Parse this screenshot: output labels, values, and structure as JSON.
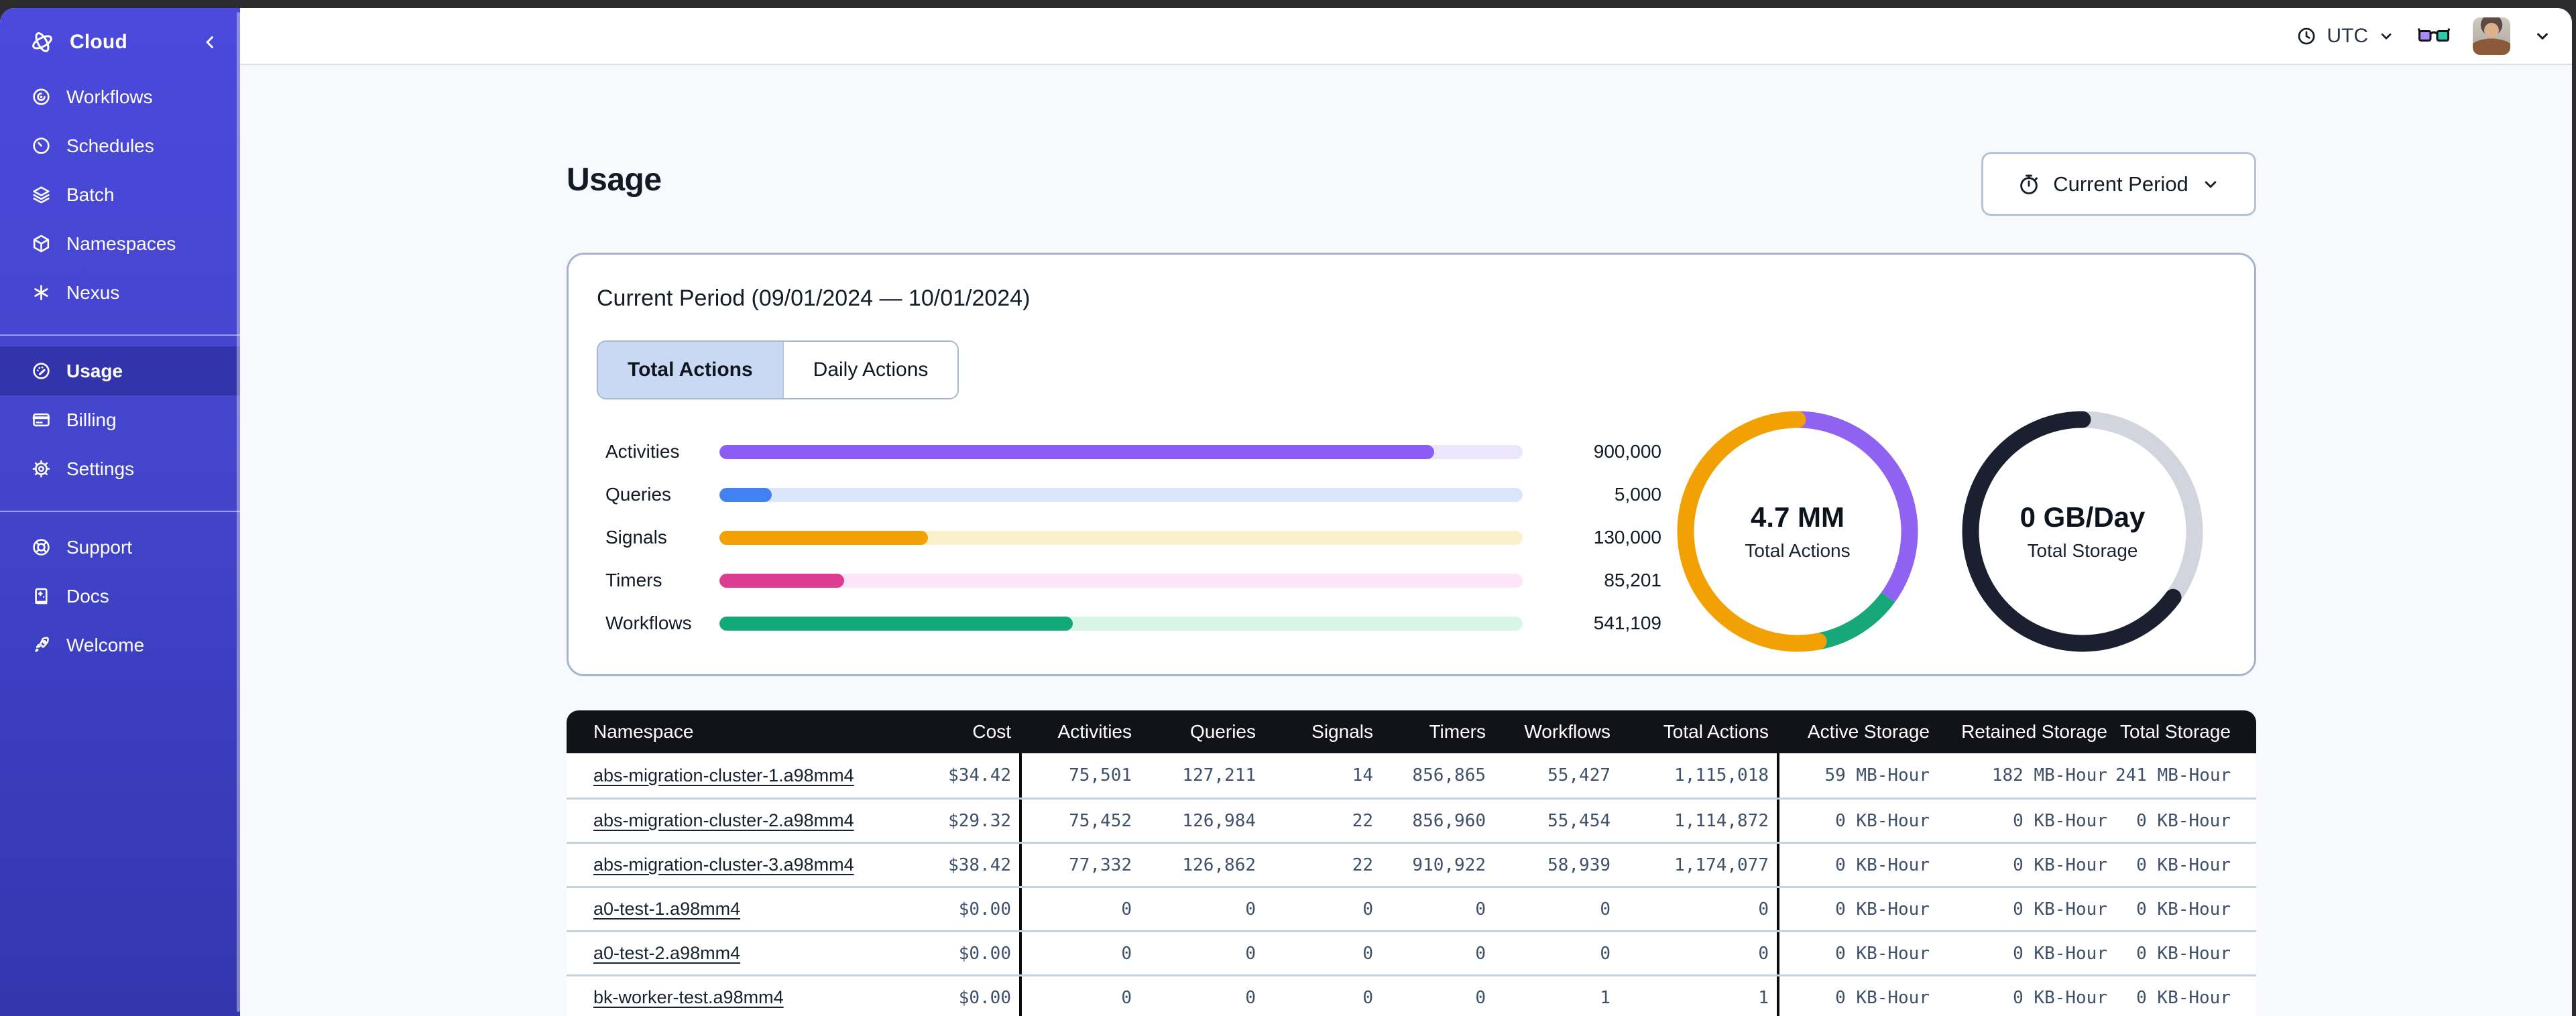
{
  "topbar": {
    "timezone": "UTC"
  },
  "sidebar": {
    "brand": "Cloud",
    "nav_primary": [
      {
        "icon": "workflows-icon",
        "label": "Workflows"
      },
      {
        "icon": "schedules-icon",
        "label": "Schedules"
      },
      {
        "icon": "batch-icon",
        "label": "Batch"
      },
      {
        "icon": "namespaces-icon",
        "label": "Namespaces"
      },
      {
        "icon": "nexus-icon",
        "label": "Nexus"
      }
    ],
    "nav_account": [
      {
        "icon": "usage-icon",
        "label": "Usage",
        "active": true
      },
      {
        "icon": "billing-icon",
        "label": "Billing"
      },
      {
        "icon": "settings-icon",
        "label": "Settings"
      }
    ],
    "nav_support": [
      {
        "icon": "support-icon",
        "label": "Support"
      },
      {
        "icon": "docs-icon",
        "label": "Docs"
      },
      {
        "icon": "welcome-icon",
        "label": "Welcome"
      }
    ]
  },
  "page": {
    "title": "Usage",
    "period_button": "Current Period"
  },
  "card": {
    "title": "Current Period (09/01/2024 — 10/01/2024)",
    "tabs": [
      {
        "label": "Total Actions",
        "active": true
      },
      {
        "label": "Daily Actions",
        "active": false
      }
    ]
  },
  "chart_data": [
    {
      "type": "bar",
      "title": "Current Period usage by action type",
      "categories": [
        "Activities",
        "Queries",
        "Signals",
        "Timers",
        "Workflows"
      ],
      "values": [
        900000,
        5000,
        130000,
        85201,
        541109
      ],
      "rows": [
        {
          "label": "Activities",
          "value_label": "900,000",
          "percent": 89,
          "color": "#8b5cf6",
          "track": "#ece6fc"
        },
        {
          "label": "Queries",
          "value_label": "5,000",
          "percent": 6.5,
          "color": "#4181f2",
          "track": "#dbe6fa"
        },
        {
          "label": "Signals",
          "value_label": "130,000",
          "percent": 26,
          "color": "#f2a104",
          "track": "#fbf0cc"
        },
        {
          "label": "Timers",
          "value_label": "85,201",
          "percent": 15.5,
          "color": "#dd3d90",
          "track": "#fae6f7"
        },
        {
          "label": "Workflows",
          "value_label": "541,109",
          "percent": 44,
          "color": "#12a877",
          "track": "#d7f6e8"
        }
      ]
    },
    {
      "type": "donut",
      "center_label": "4.7 MM",
      "sub_label": "Total Actions",
      "segments": [
        {
          "name": "purple",
          "color": "#8f62f2",
          "fraction": 0.35
        },
        {
          "name": "green",
          "color": "#16a878",
          "fraction": 0.12
        },
        {
          "name": "orange",
          "color": "#f2a104",
          "fraction": 0.53,
          "cap": "round"
        }
      ]
    },
    {
      "type": "donut",
      "center_label": "0 GB/Day",
      "sub_label": "Total Storage",
      "segments": [
        {
          "name": "gray",
          "color": "#d2d5dd",
          "fraction": 0.35
        },
        {
          "name": "navy",
          "color": "#1b2030",
          "fraction": 0.65,
          "cap": "round"
        }
      ]
    }
  ],
  "table": {
    "columns": [
      "Namespace",
      "Cost",
      "Activities",
      "Queries",
      "Signals",
      "Timers",
      "Workflows",
      "Total Actions",
      "Active Storage",
      "Retained Storage",
      "Total Storage"
    ],
    "rows": [
      [
        "abs-migration-cluster-1.a98mm4",
        "$34.42",
        "75,501",
        "127,211",
        "14",
        "856,865",
        "55,427",
        "1,115,018",
        "59 MB-Hour",
        "182 MB-Hour",
        "241 MB-Hour"
      ],
      [
        "abs-migration-cluster-2.a98mm4",
        "$29.32",
        "75,452",
        "126,984",
        "22",
        "856,960",
        "55,454",
        "1,114,872",
        "0 KB-Hour",
        "0 KB-Hour",
        "0 KB-Hour"
      ],
      [
        "abs-migration-cluster-3.a98mm4",
        "$38.42",
        "77,332",
        "126,862",
        "22",
        "910,922",
        "58,939",
        "1,174,077",
        "0 KB-Hour",
        "0 KB-Hour",
        "0 KB-Hour"
      ],
      [
        "a0-test-1.a98mm4",
        "$0.00",
        "0",
        "0",
        "0",
        "0",
        "0",
        "0",
        "0 KB-Hour",
        "0 KB-Hour",
        "0 KB-Hour"
      ],
      [
        "a0-test-2.a98mm4",
        "$0.00",
        "0",
        "0",
        "0",
        "0",
        "0",
        "0",
        "0 KB-Hour",
        "0 KB-Hour",
        "0 KB-Hour"
      ],
      [
        "bk-worker-test.a98mm4",
        "$0.00",
        "0",
        "0",
        "0",
        "0",
        "1",
        "1",
        "0 KB-Hour",
        "0 KB-Hour",
        "0 KB-Hour"
      ]
    ]
  },
  "colors": {
    "sidebar_top": "#4b49dc",
    "sidebar_bottom": "#3336ad",
    "sidebar_active": "#3a3dbf",
    "content_bg": "#f7f9fc",
    "card_border": "#a6b4ce",
    "table_header_bg": "#121319",
    "row_separator": "#c6d1df",
    "mono_text": "#3f5069",
    "tab_active_bg": "#c9d9f3"
  }
}
